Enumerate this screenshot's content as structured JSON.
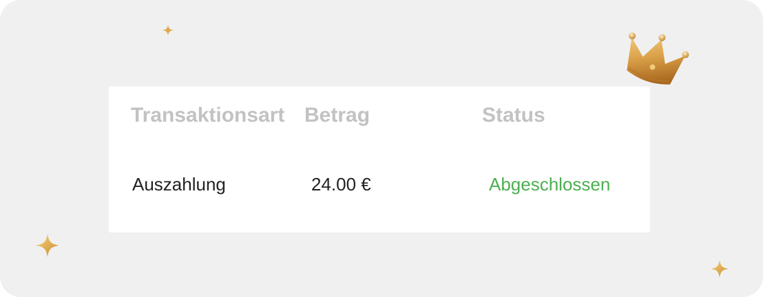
{
  "table": {
    "headers": {
      "type": "Transaktionsart",
      "amount": "Betrag",
      "status": "Status"
    },
    "rows": [
      {
        "type": "Auszahlung",
        "amount": "24.00 €",
        "status": "Abgeschlossen"
      }
    ]
  },
  "colors": {
    "background": "#f0f0f0",
    "card": "#ffffff",
    "header_text": "#c2c2c2",
    "body_text": "#222222",
    "status_success": "#4caf50",
    "gold": "#d9a441"
  },
  "icons": {
    "crown": "crown-icon",
    "sparkle": "sparkle-icon"
  }
}
